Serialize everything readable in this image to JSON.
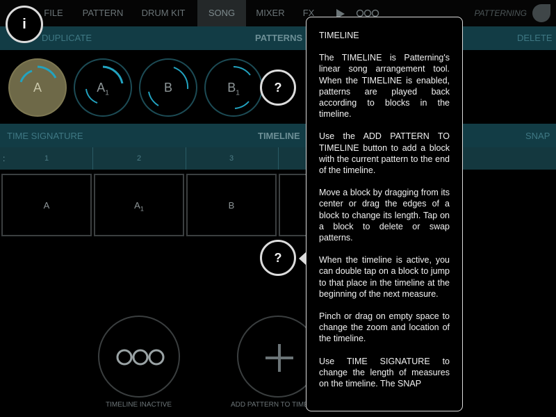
{
  "nav": {
    "tabs": [
      "FILE",
      "PATTERN",
      "DRUM KIT",
      "SONG",
      "MIXER",
      "FX"
    ],
    "active": "SONG",
    "brand": "PATTERNING"
  },
  "info_button": "i",
  "patterns_bar": {
    "duplicate": "DUPLICATE",
    "title": "PATTERNS",
    "delete": "DELETE"
  },
  "patterns": [
    {
      "label": "A",
      "sub": "",
      "selected": true
    },
    {
      "label": "A",
      "sub": "1",
      "selected": false
    },
    {
      "label": "B",
      "sub": "",
      "selected": false
    },
    {
      "label": "B",
      "sub": "1",
      "selected": false
    }
  ],
  "help_label": "?",
  "timeline_bar": {
    "time_signature": "TIME SIGNATURE",
    "title": "TIMELINE",
    "snap": "SNAP"
  },
  "ruler": {
    "measures": [
      "1",
      "2",
      "3"
    ]
  },
  "blocks": [
    {
      "label": "A",
      "sub": ""
    },
    {
      "label": "A",
      "sub": "1"
    },
    {
      "label": "B",
      "sub": ""
    }
  ],
  "buttons": {
    "timeline_inactive": "TIMELINE INACTIVE",
    "add_pattern": "ADD PATTERN TO TIMELINE"
  },
  "popover": {
    "title": "TIMELINE",
    "paragraphs": [
      "The TIMELINE is Patterning's linear song arrangement tool. When the TIMELINE is enabled, patterns are played back according to blocks in the timeline.",
      "Use the ADD PATTERN TO TIMELINE button to add a block with the current pattern to the end of the timeline.",
      "Move a block by dragging from its center or drag the edges of a block to change its length.  Tap on a block to delete or swap patterns.",
      "When the timeline is active, you can double tap on a block to jump to that place in the timeline at the beginning of the next measure.",
      "Pinch or drag on empty space to change the zoom and location of the timeline.",
      "Use TIME SIGNATURE to change the length of measures on the timeline.  The SNAP"
    ]
  },
  "colors": {
    "bar": "#123c45",
    "selected_pattern": "#6e6948",
    "accent": "#22a3c0"
  }
}
